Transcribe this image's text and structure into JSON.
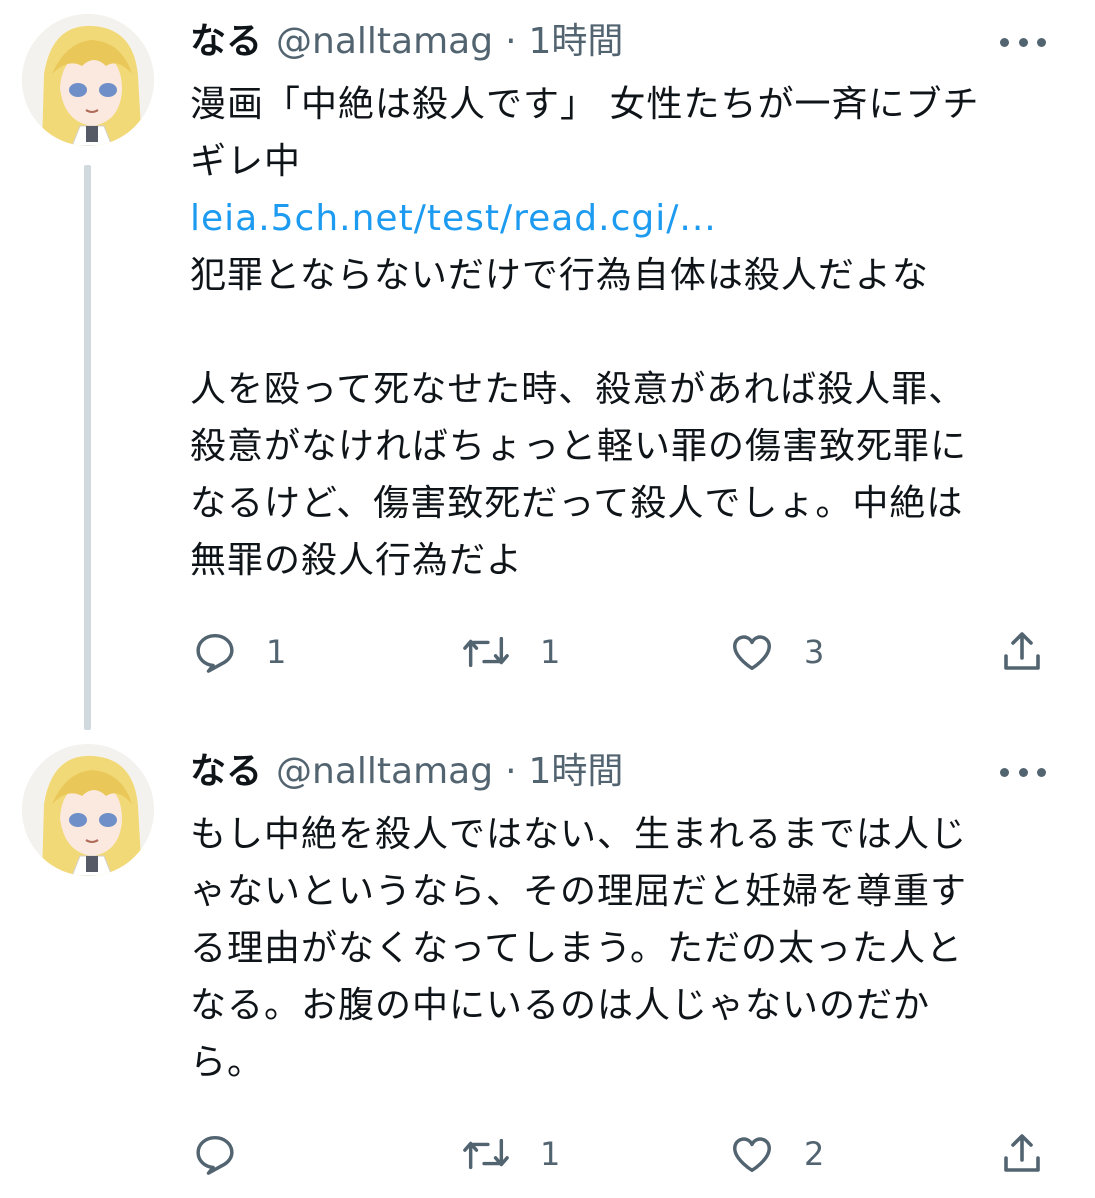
{
  "tweets": [
    {
      "author_name": "なる",
      "handle": "@nalltamag",
      "separator": "·",
      "time": "1時間",
      "lines": [
        "漫画「中絶は殺人です」 女性たちが一斉にブチ",
        "ギレ中"
      ],
      "link": "leia.5ch.net/test/read.cgi/...",
      "lines_after": [
        "犯罪とならないだけで行為自体は殺人だよな",
        "",
        "人を殴って死なせた時、殺意があれば殺人罪、",
        "殺意がなければちょっと軽い罪の傷害致死罪に",
        "なるけど、傷害致死だって殺人でしょ。中絶は",
        "無罪の殺人行為だよ"
      ],
      "replies": "1",
      "retweets": "1",
      "likes": "3"
    },
    {
      "author_name": "なる",
      "handle": "@nalltamag",
      "separator": "·",
      "time": "1時間",
      "lines": [
        "もし中絶を殺人ではない、生まれるまでは人じ",
        "ゃないというなら、その理屈だと妊婦を尊重す",
        "る理由がなくなってしまう。ただの太った人と",
        "なる。お腹の中にいるのは人じゃないのだか",
        "ら。"
      ],
      "replies": "",
      "retweets": "1",
      "likes": "2"
    }
  ],
  "icons": {
    "avatar": "anime-avatar",
    "more": "more-dots-icon",
    "reply": "reply-icon",
    "retweet": "retweet-icon",
    "like": "heart-icon",
    "share": "share-icon"
  },
  "colors": {
    "text": "#0f1419",
    "secondary": "#536471",
    "link": "#1d9bf0",
    "thread_line": "#cfd9de"
  }
}
